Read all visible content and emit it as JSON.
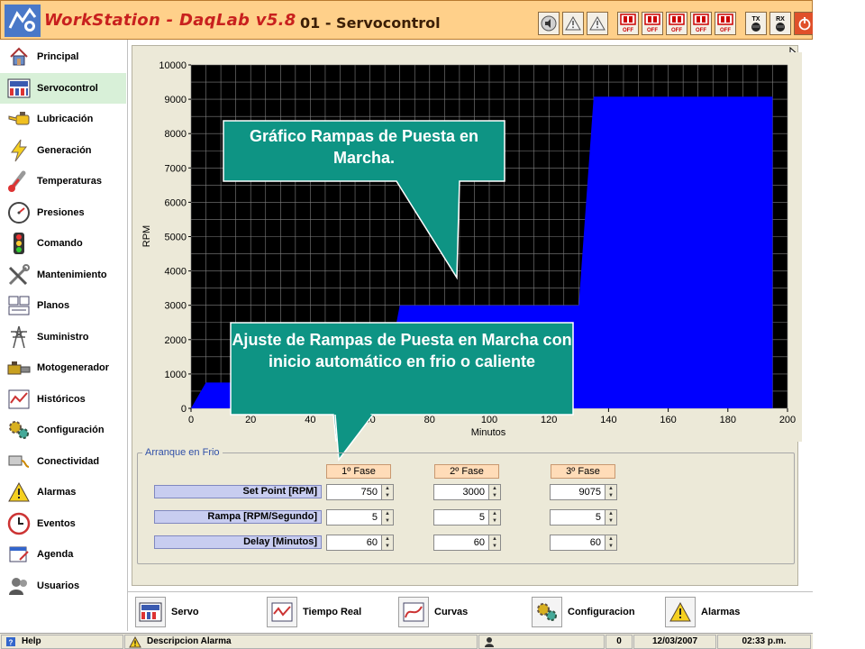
{
  "app": {
    "title": "WorkStation - DaqLab v5.8",
    "page_title": "01 - Servocontrol"
  },
  "toolbar_icons": [
    {
      "name": "speaker-icon"
    },
    {
      "name": "warning-icon"
    },
    {
      "name": "warning-icon"
    },
    {
      "name": "off-switch-1",
      "label": "OFF"
    },
    {
      "name": "off-switch-2",
      "label": "OFF"
    },
    {
      "name": "off-switch-3",
      "label": "OFF"
    },
    {
      "name": "off-switch-4",
      "label": "OFF"
    },
    {
      "name": "off-switch-5",
      "label": "OFF"
    },
    {
      "name": "tx-icon",
      "label": "TX"
    },
    {
      "name": "rx-icon",
      "label": "RX"
    },
    {
      "name": "power-icon"
    }
  ],
  "sidebar": {
    "items": [
      {
        "label": "Principal",
        "icon": "home-icon"
      },
      {
        "label": "Servocontrol",
        "icon": "servo-icon",
        "active": true
      },
      {
        "label": "Lubricación",
        "icon": "oil-can-icon"
      },
      {
        "label": "Generación",
        "icon": "lightning-icon"
      },
      {
        "label": "Temperaturas",
        "icon": "thermometer-icon"
      },
      {
        "label": "Presiones",
        "icon": "gauge-icon"
      },
      {
        "label": "Comando",
        "icon": "traffic-light-icon"
      },
      {
        "label": "Mantenimiento",
        "icon": "tools-icon"
      },
      {
        "label": "Planos",
        "icon": "blueprint-icon"
      },
      {
        "label": "Suministro",
        "icon": "power-tower-icon"
      },
      {
        "label": "Motogenerador",
        "icon": "motor-icon"
      },
      {
        "label": "Históricos",
        "icon": "history-chart-icon"
      },
      {
        "label": "Configuración",
        "icon": "gears-icon"
      },
      {
        "label": "Conectividad",
        "icon": "network-icon"
      },
      {
        "label": "Alarmas",
        "icon": "alarm-icon"
      },
      {
        "label": "Eventos",
        "icon": "clock-icon"
      },
      {
        "label": "Agenda",
        "icon": "agenda-icon"
      },
      {
        "label": "Usuarios",
        "icon": "users-icon"
      }
    ]
  },
  "callouts": {
    "chart": "Gráfico Rampas de Puesta en Marcha.",
    "settings": "Ajuste de Rampas de Puesta en Marcha con inicio automático en frio o caliente"
  },
  "chart_data": {
    "type": "area",
    "xlabel": "Minutos",
    "ylabel": "RPM",
    "xlim": [
      0,
      200
    ],
    "ylim": [
      0,
      10000
    ],
    "x_ticks": [
      0,
      20,
      40,
      60,
      80,
      100,
      120,
      140,
      160,
      180,
      200
    ],
    "y_ticks": [
      0,
      1000,
      2000,
      3000,
      4000,
      5000,
      6000,
      7000,
      8000,
      9000,
      10000
    ],
    "grid": true,
    "colors": {
      "fill": "#0000ff",
      "background": "#000000",
      "grid": "#808080"
    },
    "x": [
      0,
      5,
      65,
      70,
      130,
      135,
      195
    ],
    "y": [
      0,
      750,
      750,
      3000,
      3000,
      9075,
      9075
    ]
  },
  "arranque": {
    "title": "Arranque en Frio",
    "phases": [
      "1º Fase",
      "2º Fase",
      "3º Fase"
    ],
    "rows": [
      {
        "label": "Set Point [RPM]",
        "values": [
          "750",
          "3000",
          "9075"
        ]
      },
      {
        "label": "Rampa [RPM/Segundo]",
        "values": [
          "5",
          "5",
          "5"
        ]
      },
      {
        "label": "Delay [Minutos]",
        "values": [
          "60",
          "60",
          "60"
        ]
      }
    ]
  },
  "bottombar": {
    "items": [
      {
        "label": "Servo",
        "icon": "servo-icon"
      },
      {
        "label": "Tiempo Real",
        "icon": "realtime-chart-icon"
      },
      {
        "label": "Curvas",
        "icon": "curves-icon"
      },
      {
        "label": "Configuracion",
        "icon": "gears-icon"
      },
      {
        "label": "Alarmas",
        "icon": "warning-icon"
      }
    ]
  },
  "statusbar": {
    "help": "Help",
    "alarm_desc": "Descripcion Alarma",
    "count": "0",
    "date": "12/03/2007",
    "time": "02:33 p.m."
  }
}
